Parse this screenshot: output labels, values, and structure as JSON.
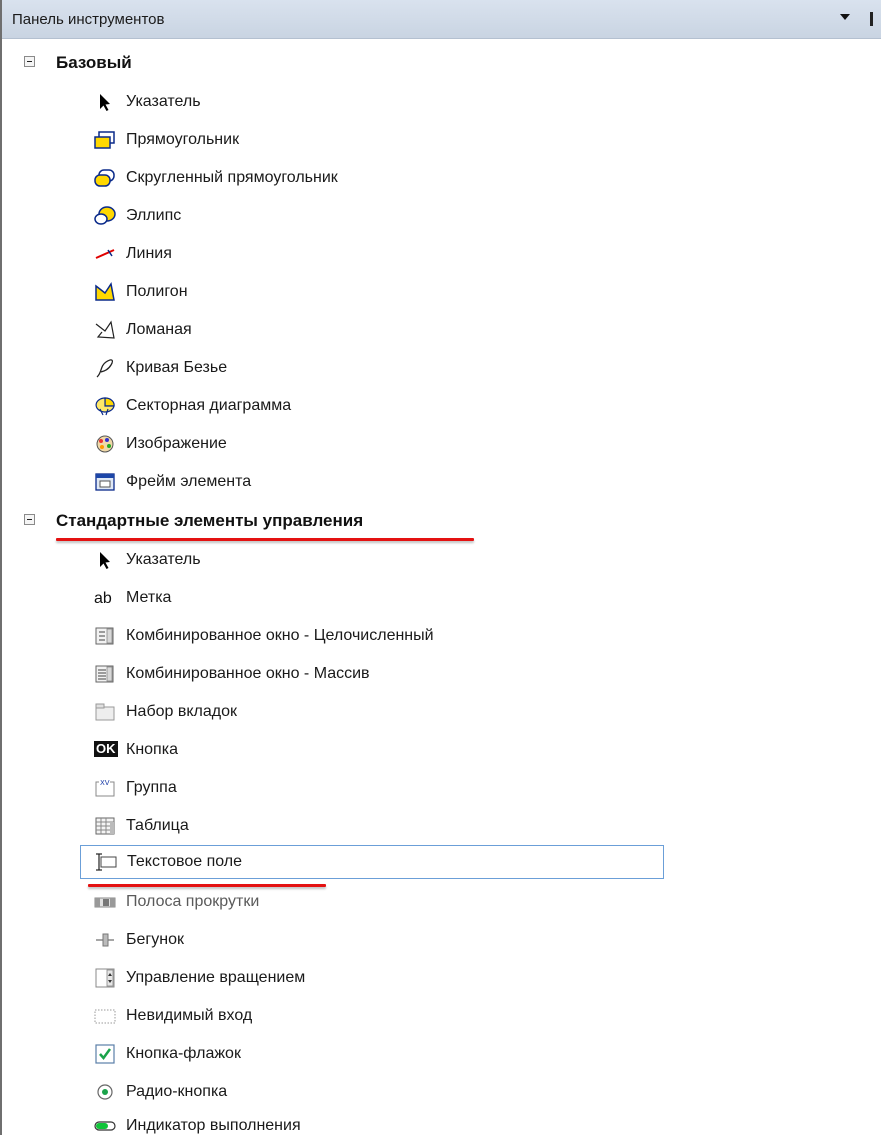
{
  "panel": {
    "title": "Панель инструментов"
  },
  "groups": [
    {
      "label": "Базовый",
      "items": [
        {
          "label": "Указатель",
          "icon": "pointer-icon"
        },
        {
          "label": "Прямоугольник",
          "icon": "rectangle-icon"
        },
        {
          "label": "Скругленный прямоугольник",
          "icon": "rounded-rectangle-icon"
        },
        {
          "label": "Эллипс",
          "icon": "ellipse-icon"
        },
        {
          "label": "Линия",
          "icon": "line-icon"
        },
        {
          "label": "Полигон",
          "icon": "polygon-icon"
        },
        {
          "label": "Ломаная",
          "icon": "polyline-icon"
        },
        {
          "label": "Кривая Безье",
          "icon": "bezier-curve-icon"
        },
        {
          "label": "Секторная диаграмма",
          "icon": "pie-chart-icon"
        },
        {
          "label": "Изображение",
          "icon": "image-icon"
        },
        {
          "label": "Фрейм элемента",
          "icon": "element-frame-icon"
        }
      ]
    },
    {
      "label": "Стандартные элементы управления",
      "items": [
        {
          "label": "Указатель",
          "icon": "pointer-icon"
        },
        {
          "label": "Метка",
          "icon": "label-icon",
          "icon_text": "ab"
        },
        {
          "label": "Комбинированное окно - Целочисленный",
          "icon": "combobox-integer-icon"
        },
        {
          "label": "Комбинированное окно - Массив",
          "icon": "combobox-array-icon"
        },
        {
          "label": "Набор вкладок",
          "icon": "tab-set-icon"
        },
        {
          "label": "Кнопка",
          "icon": "button-icon",
          "icon_text": "OK"
        },
        {
          "label": "Группа",
          "icon": "group-box-icon",
          "icon_text": "XV"
        },
        {
          "label": "Таблица",
          "icon": "table-icon"
        },
        {
          "label": "Текстовое поле",
          "icon": "text-field-icon",
          "selected": true
        },
        {
          "label": "Полоса прокрутки",
          "icon": "scrollbar-icon"
        },
        {
          "label": "Бегунок",
          "icon": "slider-icon"
        },
        {
          "label": "Управление вращением",
          "icon": "spin-control-icon"
        },
        {
          "label": "Невидимый вход",
          "icon": "invisible-input-icon"
        },
        {
          "label": "Кнопка-флажок",
          "icon": "checkbox-icon"
        },
        {
          "label": "Радио-кнопка",
          "icon": "radio-button-icon"
        },
        {
          "label": "Индикатор выполнения",
          "icon": "progress-bar-icon"
        }
      ]
    }
  ],
  "colors": {
    "accent_underline": "#e41111",
    "selection_border": "#6b9fd8",
    "titlebar_bg": "#d9e2ee"
  }
}
